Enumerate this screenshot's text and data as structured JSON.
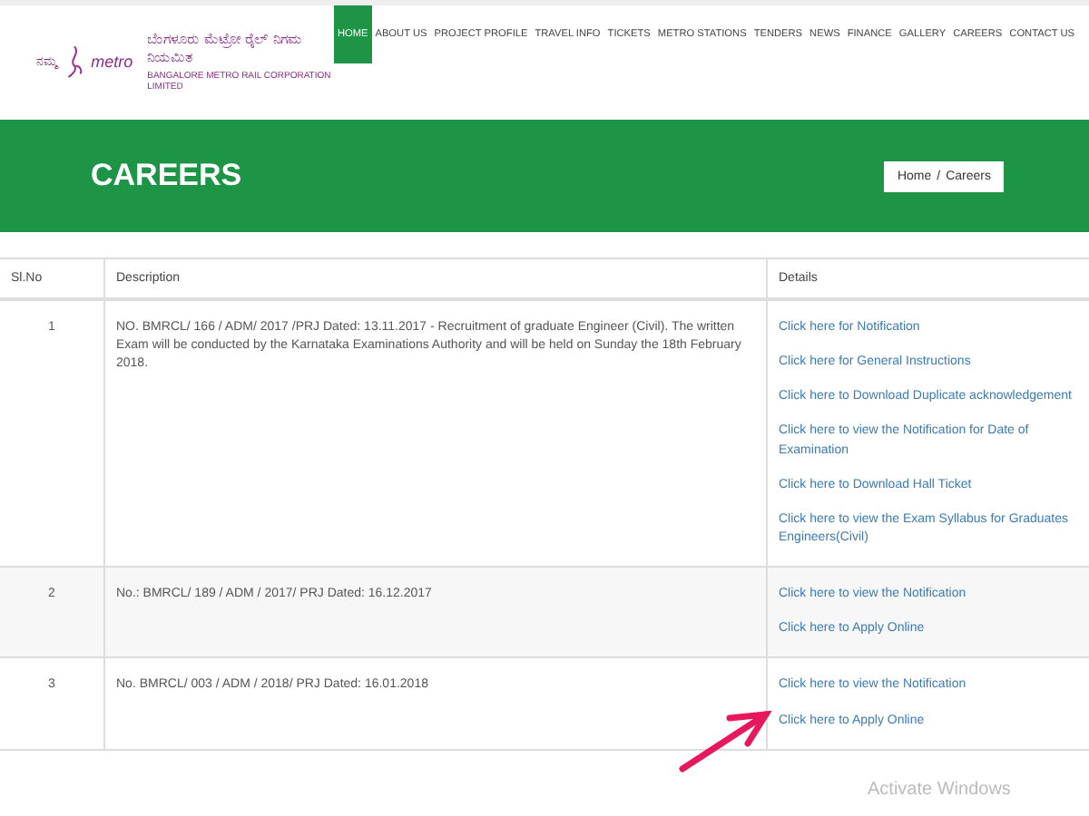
{
  "header": {
    "logo": {
      "small_text": "ನಮ್ಮ",
      "brand": "metro",
      "name_kannada": "ಬೆಂಗಳೂರು ಮೆಟ್ರೋ ರೈಲ್ ನಿಗಮ ನಿಯಮಿತ",
      "name_english": "BANGALORE METRO RAIL CORPORATION LIMITED"
    },
    "nav": [
      {
        "label": "HOME",
        "selected": true
      },
      {
        "label": "ABOUT US",
        "selected": false
      },
      {
        "label": "PROJECT PROFILE",
        "selected": false
      },
      {
        "label": "TRAVEL INFO",
        "selected": false
      },
      {
        "label": "TICKETS",
        "selected": false
      },
      {
        "label": "METRO STATIONS",
        "selected": false
      },
      {
        "label": "TENDERS",
        "selected": false
      },
      {
        "label": "NEWS",
        "selected": false
      },
      {
        "label": "FINANCE",
        "selected": false
      },
      {
        "label": "GALLERY",
        "selected": false
      },
      {
        "label": "CAREERS",
        "selected": false
      },
      {
        "label": "CONTACT US",
        "selected": false
      }
    ]
  },
  "banner": {
    "title": "CAREERS",
    "breadcrumb": [
      "Home",
      "/",
      "Careers"
    ]
  },
  "table": {
    "columns": [
      "Sl.No",
      "Description",
      "Details"
    ],
    "rows": [
      {
        "sl_no": "1",
        "description": "NO. BMRCL/ 166 / ADM/ 2017 /PRJ Dated: 13.11.2017 - Recruitment of graduate Engineer (Civil). The written Exam will be conducted by the Karnataka Examinations Authority and will be held on Sunday the 18th February 2018.",
        "links": [
          "Click here for Notification",
          "Click here for General Instructions",
          "Click here to Download Duplicate acknowledgement",
          "Click here to view the Notification for Date of Examination",
          "Click here to Download Hall Ticket",
          "Click here to view the Exam Syllabus for Graduates Engineers(Civil)"
        ]
      },
      {
        "sl_no": "2",
        "description": "No.: BMRCL/ 189 / ADM / 2017/ PRJ Dated: 16.12.2017",
        "links": [
          "Click here to view the Notification",
          "Click here to Apply Online"
        ]
      },
      {
        "sl_no": "3",
        "description": "No. BMRCL/ 003 / ADM / 2018/ PRJ Dated: 16.01.2018",
        "links": [
          "Click here to view the Notification",
          "Click here to Apply Online"
        ]
      }
    ]
  },
  "os_notice": "Activate Windows"
}
